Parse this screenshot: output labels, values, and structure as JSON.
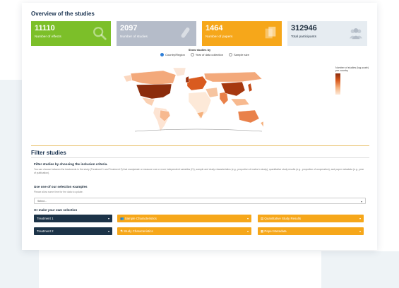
{
  "overview": {
    "title": "Overview of the studies",
    "stats": [
      {
        "value": "11110",
        "label": "Number of effects",
        "color": "#7cbf29",
        "icon": "search-icon"
      },
      {
        "value": "2097",
        "label": "Number of studies",
        "color": "#b5bcc9",
        "icon": "test-tube-icon"
      },
      {
        "value": "1464",
        "label": "Number of papers",
        "color": "#f6a71a",
        "icon": "documents-icon"
      },
      {
        "value": "312946",
        "label": "Total participants",
        "color": "#e6ecf1",
        "icon": "users-icon"
      }
    ],
    "show_by": {
      "label": "Show studies by",
      "options": [
        "Country/Region",
        "Year of data collection",
        "Sample size"
      ],
      "selected": "Country/Region"
    },
    "legend": {
      "title": "Number of studies (log-scale) per country",
      "ticks": [
        "",
        "",
        "",
        "",
        ""
      ]
    }
  },
  "filter": {
    "title": "Filter studies",
    "subtitle": "Filter studies by choosing the inclusion criteria.",
    "description": "You can choose between the treatments in the study (Treatment 1 and Treatment 2) that manipulate or measure one or more independent variables (IV), sample and study characteristics (e.g., proportion of males in study), quantitative study results (e.g., proportion of cooperation), and paper metadata (e.g., year of publication).",
    "examples_title": "Use one of our selection examples",
    "examples_note": "Please allow some time for the data to update.",
    "select_placeholder": "Select...",
    "own_title": "Or make your own selection",
    "buttons": {
      "treatment1": "Treatment 1",
      "treatment2": "Treatment 2",
      "sample": "Sample Characteristics",
      "study": "Study Characteristics",
      "quant": "Quantitative Study Results",
      "meta": "Paper Metadata"
    }
  },
  "colors": {
    "accent_green": "#7cbf29",
    "accent_orange": "#f6a71a",
    "navy": "#1c3348"
  }
}
